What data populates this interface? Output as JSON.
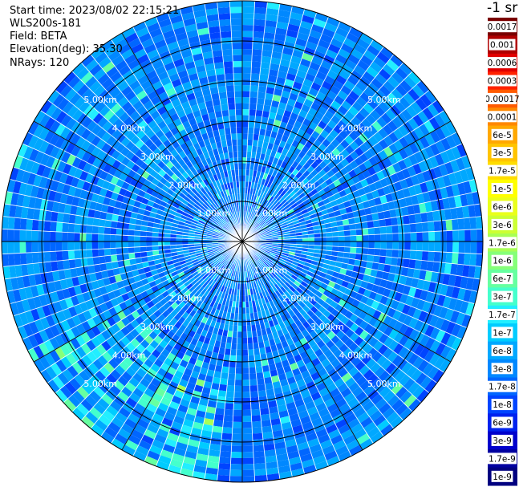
{
  "header": {
    "start_time": "Start time: 2023/08/02 22:15:21",
    "instrument": "WLS200s-181",
    "field": "Field: BETA",
    "elevation": "Elevation(deg): 35.30",
    "nrays": "NRays: 120"
  },
  "chart_data": {
    "type": "heatmap",
    "projection": "polar",
    "n_rays": 120,
    "range_rings_km": [
      1,
      2,
      3,
      4,
      5
    ],
    "range_labels": [
      "1.00km",
      "2.00km",
      "3.00km",
      "4.00km",
      "5.00km"
    ],
    "max_range_km": 6.0,
    "colorbar": {
      "unit_label": "-1 sr",
      "tick_labels": [
        "0.0017",
        "0.001",
        "0.0006",
        "0.0003",
        "0.00017",
        "0.0001",
        "6e-5",
        "3e-5",
        "1.7e-5",
        "1e-5",
        "6e-6",
        "3e-6",
        "1.7e-6",
        "1e-6",
        "6e-7",
        "3e-7",
        "1.7e-7",
        "1e-7",
        "6e-8",
        "3e-8",
        "1.7e-8",
        "1e-8",
        "6e-9",
        "3e-9",
        "1.7e-9",
        "1e-9"
      ],
      "colors": [
        "#7a0000",
        "#b00000",
        "#e00000",
        "#ff2200",
        "#ff5a00",
        "#ff8800",
        "#ffa800",
        "#ffc400",
        "#ffdd00",
        "#ffff00",
        "#eaff1a",
        "#ccff33",
        "#a8ff55",
        "#86ff78",
        "#66ffa0",
        "#44ffcc",
        "#22eeff",
        "#00ccff",
        "#00a8ff",
        "#0088ff",
        "#0066ff",
        "#0044ff",
        "#0022ee",
        "#0000cc",
        "#0000a0",
        "#000080"
      ]
    },
    "dominant_range": "1e-7 to 1e-8"
  }
}
